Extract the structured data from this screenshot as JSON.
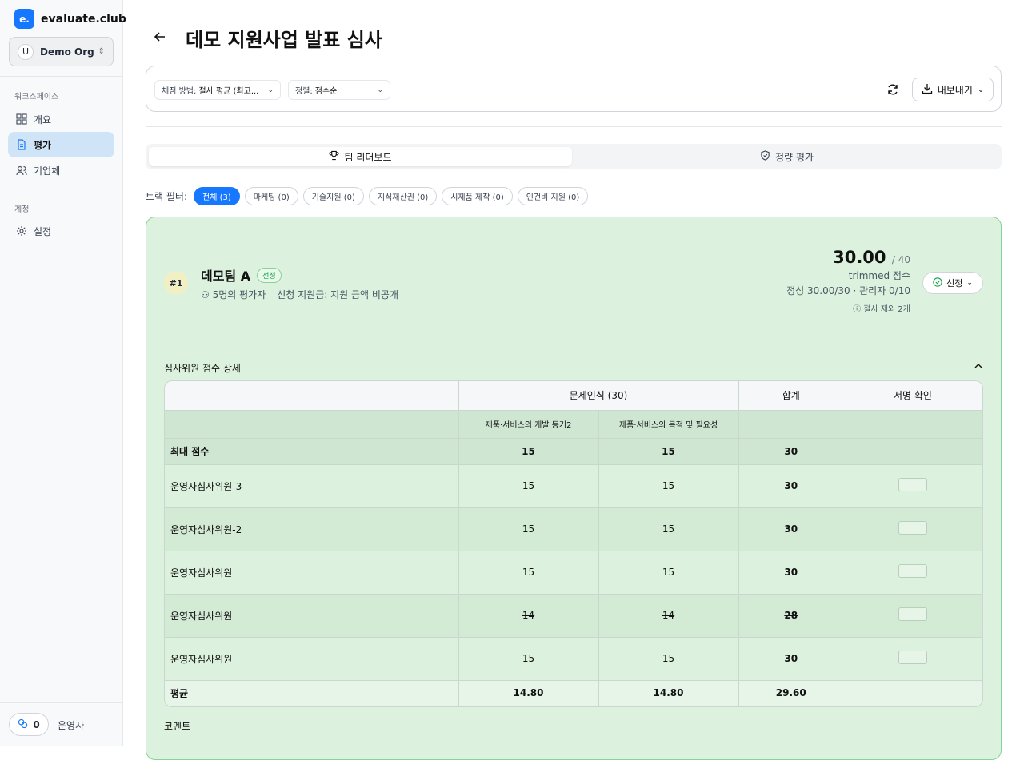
{
  "brand": {
    "logo": "e.",
    "name": "evaluate.club"
  },
  "org": {
    "avatar": "U",
    "name": "Demo Org"
  },
  "sidebar": {
    "workspace_label": "워크스페이스",
    "items": [
      {
        "label": "개요",
        "icon": "grid-icon"
      },
      {
        "label": "평가",
        "icon": "document-icon"
      },
      {
        "label": "기업체",
        "icon": "users-icon"
      }
    ],
    "account_label": "계정",
    "settings": {
      "label": "설정",
      "icon": "gear-icon"
    }
  },
  "user": {
    "count": "0",
    "role": "운영자"
  },
  "page": {
    "title": "데모 지원사업 발표 심사"
  },
  "toolbar": {
    "scoring_label": "채점 방법:",
    "scoring_value": "절사 평균 (최고...",
    "sort_label": "정렬:",
    "sort_value": "점수순",
    "export_label": "내보내기"
  },
  "tabs": [
    {
      "label": "팀 리더보드",
      "icon": "trophy-icon"
    },
    {
      "label": "정량 평가",
      "icon": "shield-icon"
    }
  ],
  "filters": {
    "label": "트랙 필터:",
    "chips": [
      "전체 (3)",
      "마케팅 (0)",
      "기술지원 (0)",
      "지식재산권 (0)",
      "시제품 제작 (0)",
      "인건비 지원 (0)"
    ]
  },
  "team": {
    "rank": "#1",
    "name": "데모팀 A",
    "badge": "선정",
    "evaluators": "5명의 평가자",
    "funding": "신청 지원금: 지원 금액 비공개",
    "score": "30.00",
    "max": "/ 40",
    "score_type": "trimmed 점수",
    "breakdown": "정성 30.00/30 · 관리자 0/10",
    "trim_note": "절사 제외 2개",
    "select_label": "선정"
  },
  "detail": {
    "title": "심사위원 점수 상세",
    "headers": {
      "category": "문제인식 (30)",
      "total": "합계",
      "signature": "서명 확인"
    },
    "subheaders": [
      "제품·서비스의 개발 동기2",
      "제품·서비스의 목적 및 필요성"
    ],
    "max_row": {
      "label": "최대 점수",
      "c1": "15",
      "c2": "15",
      "total": "30"
    },
    "rows": [
      {
        "name": "운영자심사위원-3",
        "c1": "15",
        "c2": "15",
        "total": "30"
      },
      {
        "name": "운영자심사위원-2",
        "c1": "15",
        "c2": "15",
        "total": "30"
      },
      {
        "name": "운영자심사위원",
        "c1": "15",
        "c2": "15",
        "total": "30"
      },
      {
        "name": "운영자심사위원",
        "c1": "14",
        "c2": "14",
        "total": "28"
      },
      {
        "name": "운영자심사위원",
        "c1": "15",
        "c2": "15",
        "total": "30"
      }
    ],
    "avg_row": {
      "label": "평균",
      "c1": "14.80",
      "c2": "14.80",
      "total": "29.60"
    }
  },
  "comment_label": "코멘트"
}
